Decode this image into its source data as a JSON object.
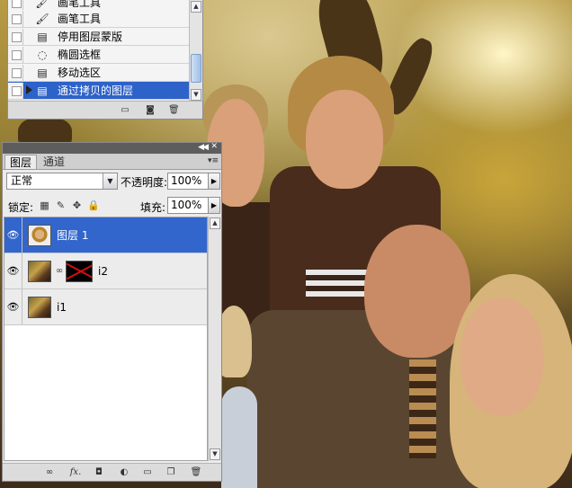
{
  "history": {
    "items": [
      {
        "label": "画笔工具",
        "icon": "brush-icon",
        "selected": false
      },
      {
        "label": "画笔工具",
        "icon": "brush-icon",
        "selected": false
      },
      {
        "label": "停用图层蒙版",
        "icon": "document-icon",
        "selected": false
      },
      {
        "label": "椭圆选框",
        "icon": "ellipse-marquee-icon",
        "selected": false
      },
      {
        "label": "移动选区",
        "icon": "document-icon",
        "selected": false
      },
      {
        "label": "通过拷贝的图层",
        "icon": "document-icon",
        "selected": true
      }
    ]
  },
  "layers_panel": {
    "tabs": [
      "图层",
      "通道"
    ],
    "blend_mode": "正常",
    "opacity_label": "不透明度:",
    "opacity_value": "100%",
    "lock_label": "锁定:",
    "fill_label": "填充:",
    "fill_value": "100%",
    "layers": [
      {
        "name": "图层 1",
        "selected": true
      },
      {
        "name": "i2",
        "selected": false,
        "has_mask": true
      },
      {
        "name": "i1",
        "selected": false
      }
    ]
  },
  "colors": {
    "selection": "#3366cc",
    "panel_bg": "#ececec"
  }
}
